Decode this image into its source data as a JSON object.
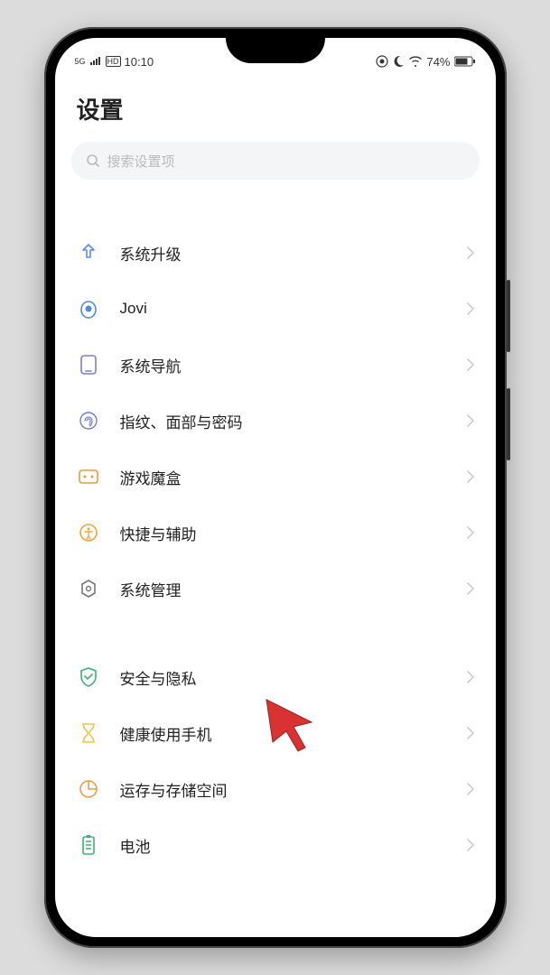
{
  "status": {
    "time": "10:10",
    "battery": "74%",
    "signal_label": "5G"
  },
  "header": {
    "title": "设置"
  },
  "search": {
    "placeholder": "搜索设置项"
  },
  "groups": [
    {
      "items": [
        {
          "icon": "upgrade-icon",
          "label": "系统升级",
          "color": "#5a8af6"
        },
        {
          "icon": "jovi-icon",
          "label": "Jovi",
          "color": "#4f8bd6"
        },
        {
          "icon": "nav-icon",
          "label": "系统导航",
          "color": "#7a7fd9"
        },
        {
          "icon": "fingerprint-icon",
          "label": "指纹、面部与密码",
          "color": "#6f7bd6"
        },
        {
          "icon": "gamebox-icon",
          "label": "游戏魔盒",
          "color": "#e29a3c"
        },
        {
          "icon": "accessibility-icon",
          "label": "快捷与辅助",
          "color": "#f2a43a"
        },
        {
          "icon": "system-mgmt-icon",
          "label": "系统管理",
          "color": "#777"
        }
      ]
    },
    {
      "items": [
        {
          "icon": "security-icon",
          "label": "安全与隐私",
          "color": "#3bb273"
        },
        {
          "icon": "digital-wellbeing-icon",
          "label": "健康使用手机",
          "color": "#f2c24b"
        },
        {
          "icon": "storage-icon",
          "label": "运存与存储空间",
          "color": "#f29b4b"
        },
        {
          "icon": "battery-icon",
          "label": "电池",
          "color": "#3bb273"
        }
      ]
    }
  ]
}
